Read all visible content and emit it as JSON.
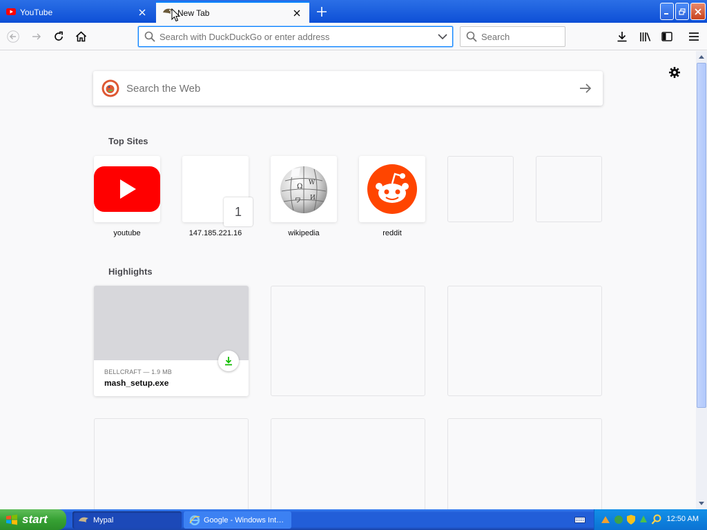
{
  "tabs": [
    {
      "title": "YouTube",
      "favicon": "youtube-icon"
    },
    {
      "title": "New Tab",
      "favicon": "mypal-icon"
    }
  ],
  "urlbar": {
    "placeholder": "Search with DuckDuckGo or enter address"
  },
  "searchbar": {
    "placeholder": "Search"
  },
  "newtab": {
    "web_search_placeholder": "Search the Web",
    "top_sites_title": "Top Sites",
    "top_sites": [
      {
        "label": "youtube",
        "icon": "youtube-logo"
      },
      {
        "label": "147.185.221.16",
        "badge": "1"
      },
      {
        "label": "wikipedia",
        "icon": "wikipedia-globe"
      },
      {
        "label": "reddit",
        "icon": "reddit-logo"
      },
      {
        "label": ""
      },
      {
        "label": ""
      }
    ],
    "highlights_title": "Highlights",
    "highlight": {
      "meta": "BELLCRAFT — 1.9 MB",
      "name": "mash_setup.exe"
    }
  },
  "taskbar": {
    "start_label": "start",
    "tasks": [
      {
        "label": "Mypal"
      },
      {
        "label": "Google - Windows Int…"
      }
    ],
    "clock": "12:50 AM"
  },
  "colors": {
    "accent": "#0a84ff",
    "youtube_red": "#ff0000",
    "reddit_orange": "#ff4500",
    "download_green": "#12bc00"
  }
}
